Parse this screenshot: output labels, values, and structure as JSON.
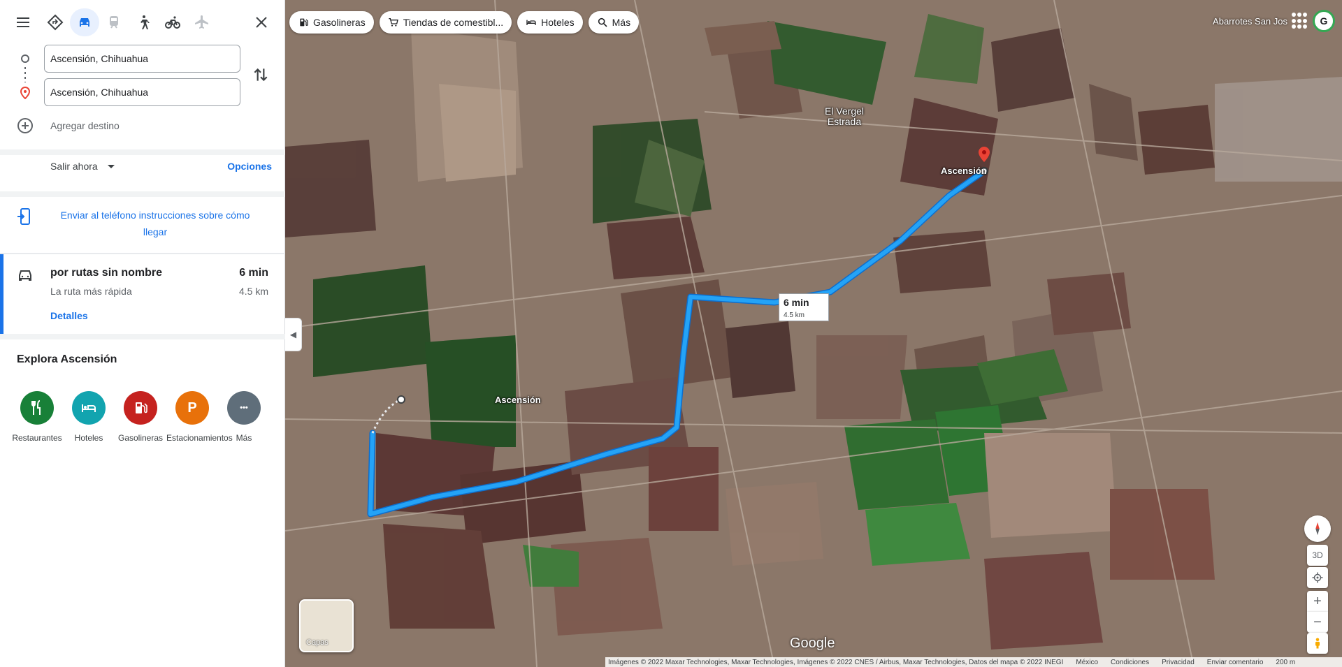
{
  "panel": {
    "modes": [
      {
        "name": "best-travel-mode",
        "icon": "diamond-directions-icon"
      },
      {
        "name": "driving",
        "icon": "car-icon",
        "selected": true
      },
      {
        "name": "transit",
        "icon": "train-icon"
      },
      {
        "name": "walking",
        "icon": "walking-icon"
      },
      {
        "name": "cycling",
        "icon": "bicycle-icon"
      },
      {
        "name": "flights",
        "icon": "airplane-icon"
      }
    ],
    "origin": "Ascensión, Chihuahua",
    "destination": "Ascensión, Chihuahua",
    "add_destination": "Agregar destino",
    "depart": "Salir ahora",
    "options": "Opciones",
    "send_to_phone": "Enviar al teléfono instrucciones sobre cómo llegar",
    "route": {
      "name": "por rutas sin nombre",
      "subtitle": "La ruta más rápida",
      "duration": "6 min",
      "distance": "4.5 km",
      "details": "Detalles"
    },
    "explore_title": "Explora Ascensión",
    "explore": [
      {
        "label": "Restaurantes",
        "color": "#188038",
        "icon": "restaurant-icon"
      },
      {
        "label": "Hoteles",
        "color": "#12a4af",
        "icon": "hotel-icon"
      },
      {
        "label": "Gasolineras",
        "color": "#c5221f",
        "icon": "gas-station-icon"
      },
      {
        "label": "Estacionamientos",
        "color": "#e8710a",
        "icon": "parking-icon",
        "glyph": "P"
      },
      {
        "label": "Más",
        "color": "#5f6e7a",
        "icon": "more-icon",
        "glyph": "•••"
      }
    ]
  },
  "map": {
    "chips": [
      {
        "label": "Gasolineras",
        "icon": "gas-station-icon"
      },
      {
        "label": "Tiendas de comestibl...",
        "icon": "cart-icon"
      },
      {
        "label": "Hoteles",
        "icon": "hotel-icon"
      },
      {
        "label": "Más",
        "icon": "search-icon"
      }
    ],
    "route_label": {
      "duration": "6 min",
      "distance": "4.5 km"
    },
    "places": {
      "vergel": "El Vergel Estrada",
      "dest": "Ascensión",
      "origin": "Ascensión",
      "store": "Abarrotes San Jos"
    },
    "layers_label": "Capas",
    "view_3d": "3D",
    "logo": "Google",
    "footer": {
      "attribution": "Imágenes © 2022 Maxar Technologies, Maxar Technologies, Imágenes © 2022 CNES / Airbus, Maxar Technologies, Datos del mapa © 2022 INEGI",
      "country": "México",
      "terms": "Condiciones",
      "privacy": "Privacidad",
      "feedback": "Enviar comentario",
      "scale": "200 m"
    },
    "route_color": "#1a9bf0"
  }
}
